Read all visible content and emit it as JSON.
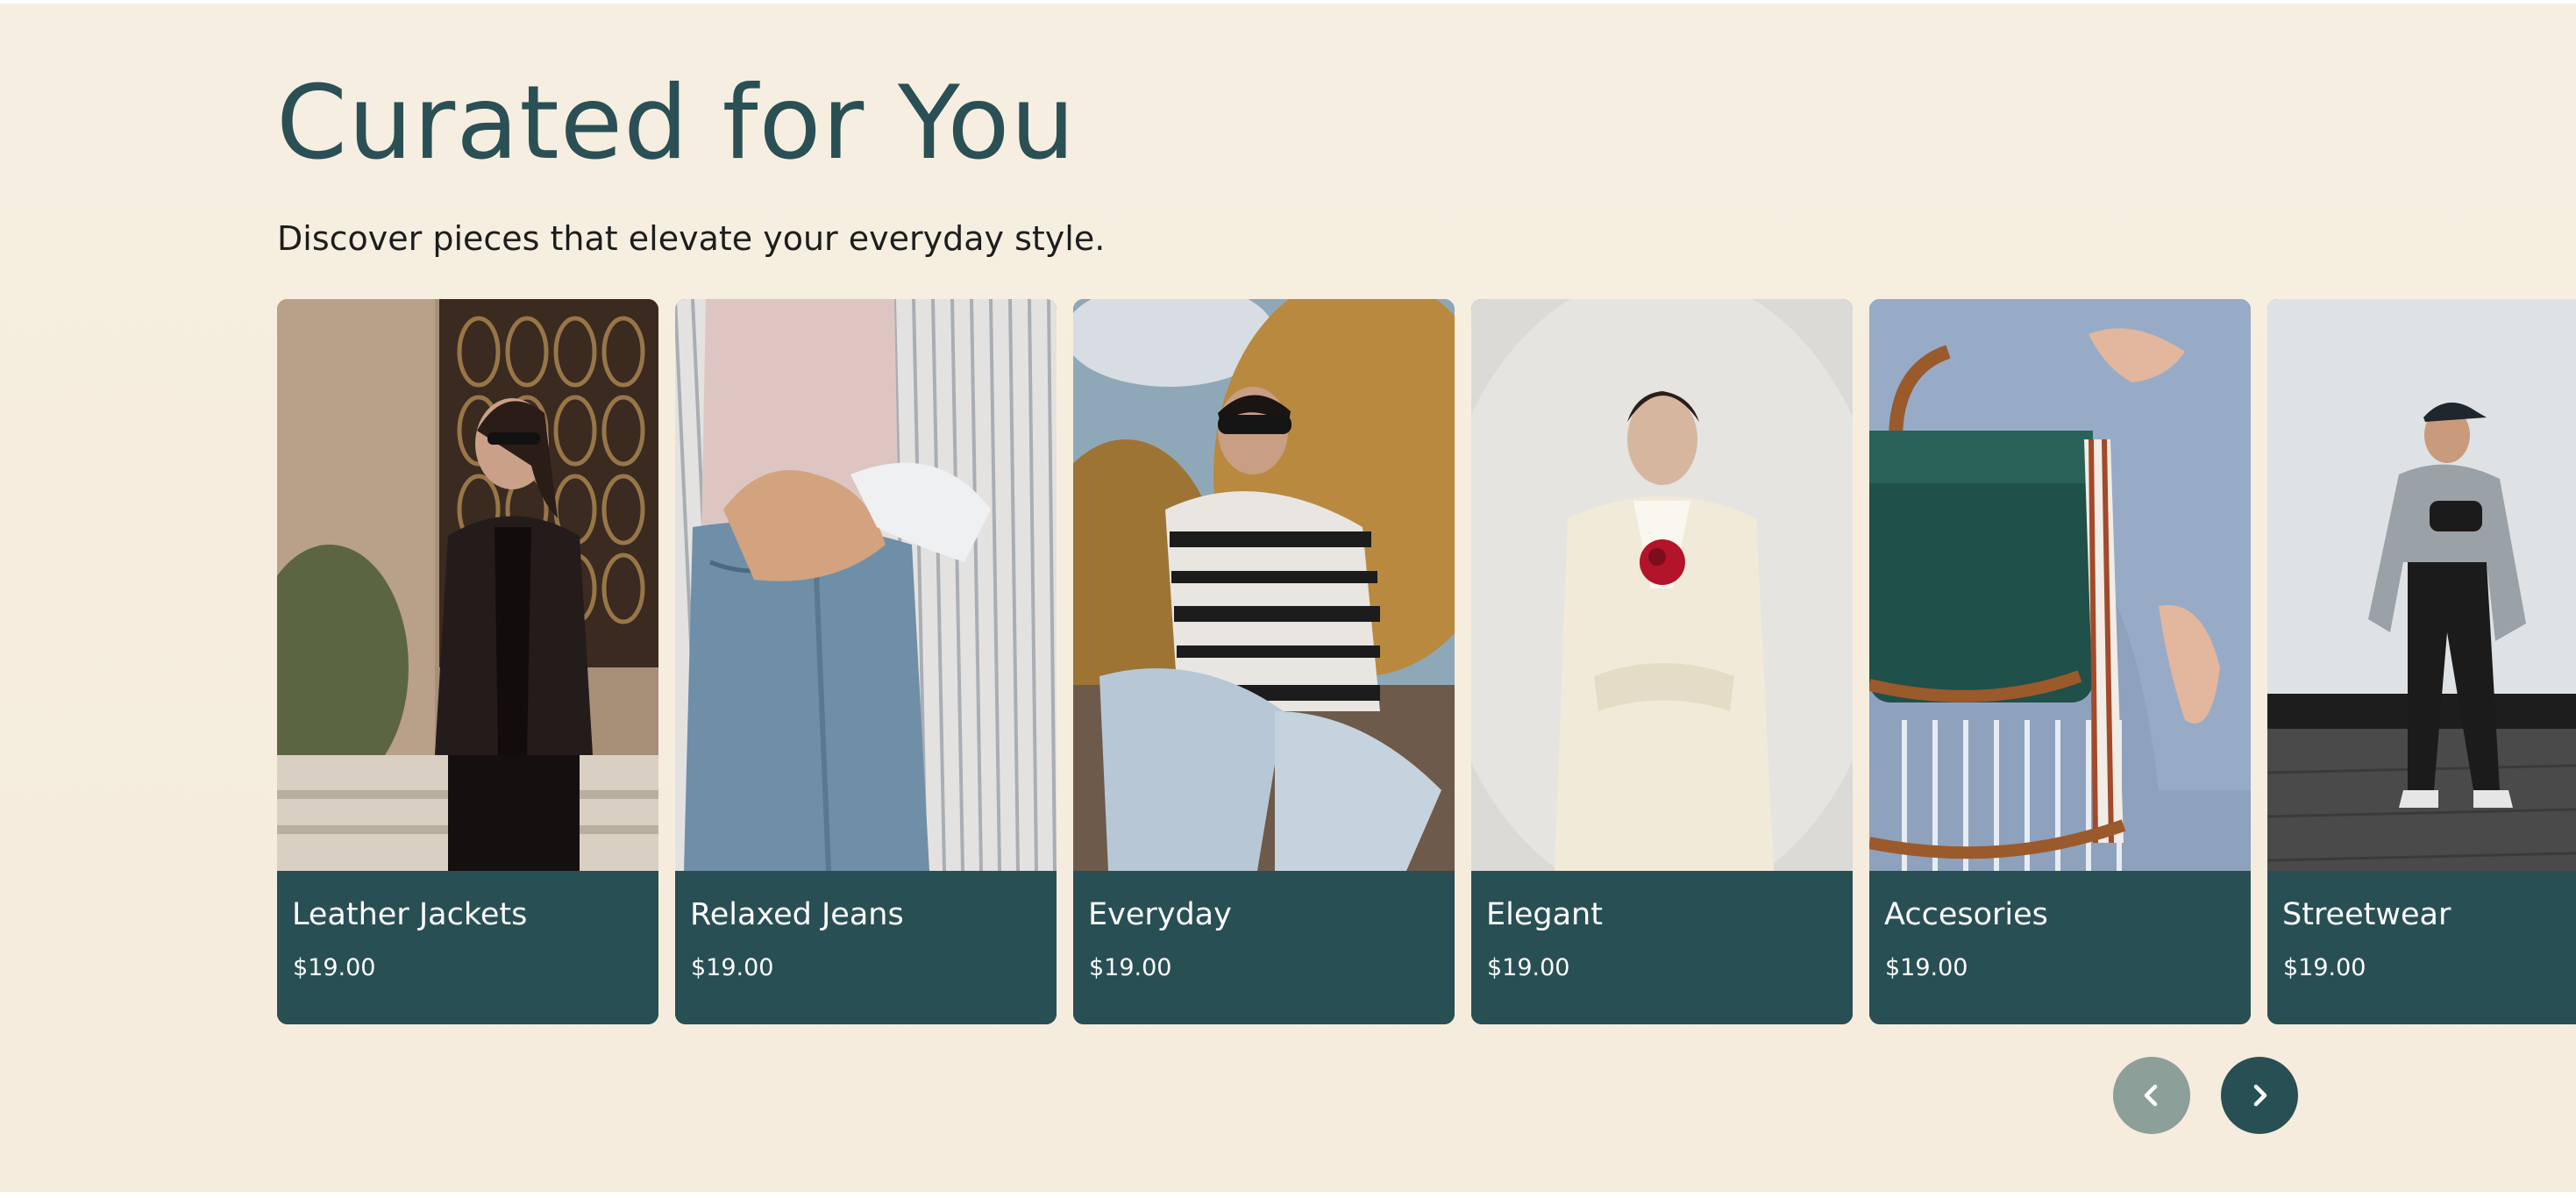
{
  "section": {
    "title": "Curated for You",
    "subtitle": "Discover pieces that elevate your everyday style."
  },
  "products": [
    {
      "name": "Leather Jackets",
      "price": "$19.00",
      "image": "woman-in-black-leather-jacket-photo"
    },
    {
      "name": "Relaxed Jeans",
      "price": "$19.00",
      "image": "hand-in-jeans-pocket-photo"
    },
    {
      "name": "Everyday",
      "price": "$19.00",
      "image": "woman-in-patterned-sweater-photo"
    },
    {
      "name": "Elegant",
      "price": "$19.00",
      "image": "woman-in-cream-suit-photo"
    },
    {
      "name": "Accesories",
      "price": "$19.00",
      "image": "green-handbag-photo"
    },
    {
      "name": "Streetwear",
      "price": "$19.00",
      "image": "woman-in-grey-streetwear-photo"
    }
  ],
  "carousel": {
    "prev_icon": "chevron-left-icon",
    "next_icon": "chevron-right-icon"
  },
  "colors": {
    "background": "#f6eee0",
    "accent": "#284f54",
    "prev_button": "#8c9f98"
  }
}
